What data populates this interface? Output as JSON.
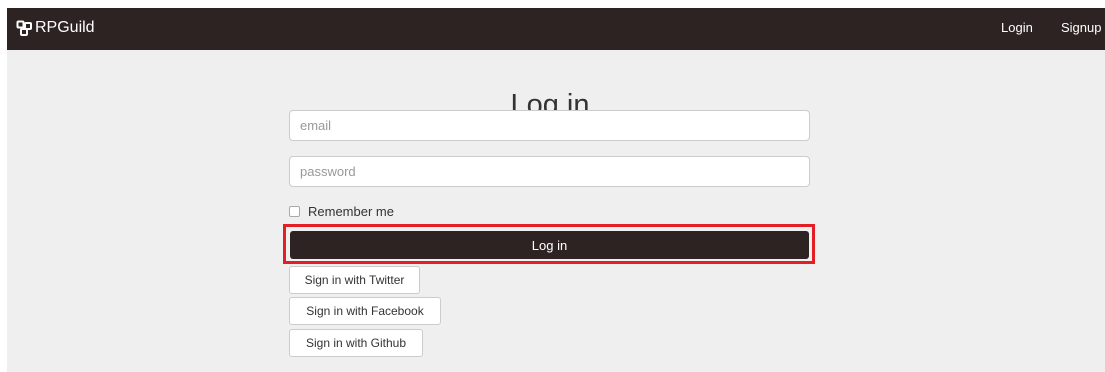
{
  "navbar": {
    "brand": "RPGuild",
    "brand_icon": "dice-icon",
    "login": "Login",
    "signup": "Signup",
    "background": "#2d2322"
  },
  "form": {
    "title": "Log in",
    "email_placeholder": "email",
    "password_placeholder": "password",
    "remember_label": "Remember me",
    "submit_label": "Log in",
    "submit_color": "#2d2322",
    "highlight_color": "#e31e25"
  },
  "social": {
    "twitter": "Sign in with Twitter",
    "facebook": "Sign in with Facebook",
    "github": "Sign in with Github"
  }
}
